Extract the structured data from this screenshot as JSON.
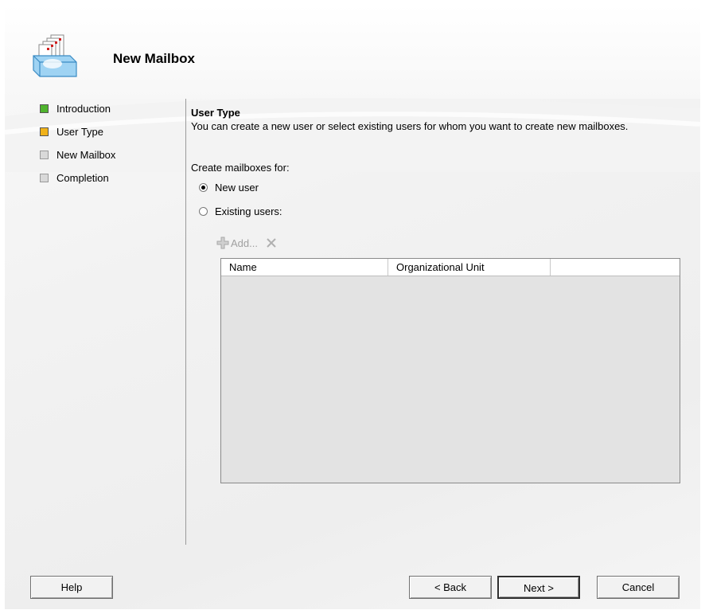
{
  "wizard": {
    "title": "New Mailbox"
  },
  "nav": {
    "items": [
      {
        "label": "Introduction",
        "status": "completed",
        "color": "#4fb42e"
      },
      {
        "label": "User Type",
        "status": "current",
        "color": "#f0b21a"
      },
      {
        "label": "New Mailbox",
        "status": "pending",
        "color": "#d9d9d9"
      },
      {
        "label": "Completion",
        "status": "pending",
        "color": "#d9d9d9"
      }
    ]
  },
  "page": {
    "section_title": "User Type",
    "description": "You can create a new user or select existing users for whom you want to create new mailboxes.",
    "group_label": "Create mailboxes for:",
    "options": [
      {
        "label": "New user",
        "selected": true
      },
      {
        "label": "Existing users:",
        "selected": false
      }
    ],
    "toolbar": {
      "add_label": "Add...",
      "add_icon": "add-icon",
      "remove_icon": "remove-icon"
    },
    "table": {
      "columns": [
        "Name",
        "Organizational Unit",
        ""
      ],
      "rows": []
    }
  },
  "buttons": {
    "help": "Help",
    "back": "< Back",
    "next": "Next >",
    "cancel": "Cancel"
  }
}
